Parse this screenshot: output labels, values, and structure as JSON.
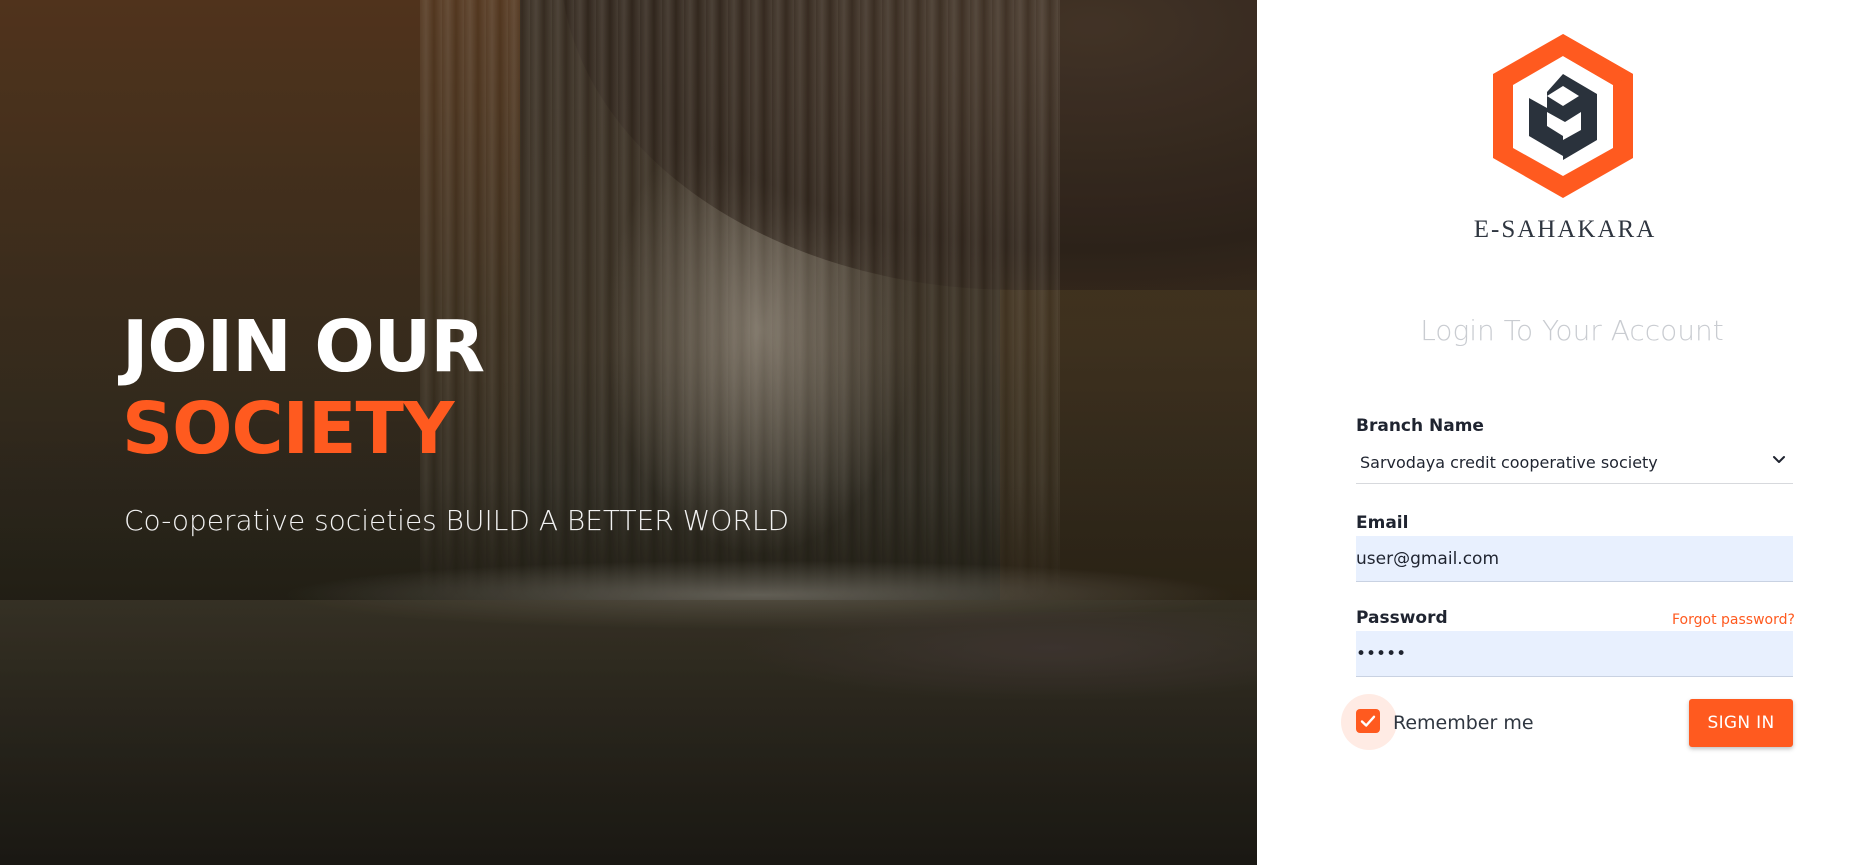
{
  "hero": {
    "headline_line1": "JOIN OUR",
    "headline_line2": "SOCIETY",
    "tagline": "Co-operative societies BUILD A BETTER WORLD"
  },
  "brand": {
    "name": "E-SAHAKARA"
  },
  "login": {
    "title": "Login To Your Account",
    "branch_label": "Branch Name",
    "branch_value": "Sarvodaya credit cooperative society",
    "email_label": "Email",
    "email_value": "user@gmail.com",
    "password_label": "Password",
    "password_value": "•••••",
    "forgot_label": "Forgot password?",
    "remember_label": "Remember me",
    "remember_checked": true,
    "signin_label": "SIGN IN"
  },
  "colors": {
    "accent": "#ff5a1f",
    "logo_dark": "#2a323c",
    "input_bg": "#e8f0fe"
  }
}
